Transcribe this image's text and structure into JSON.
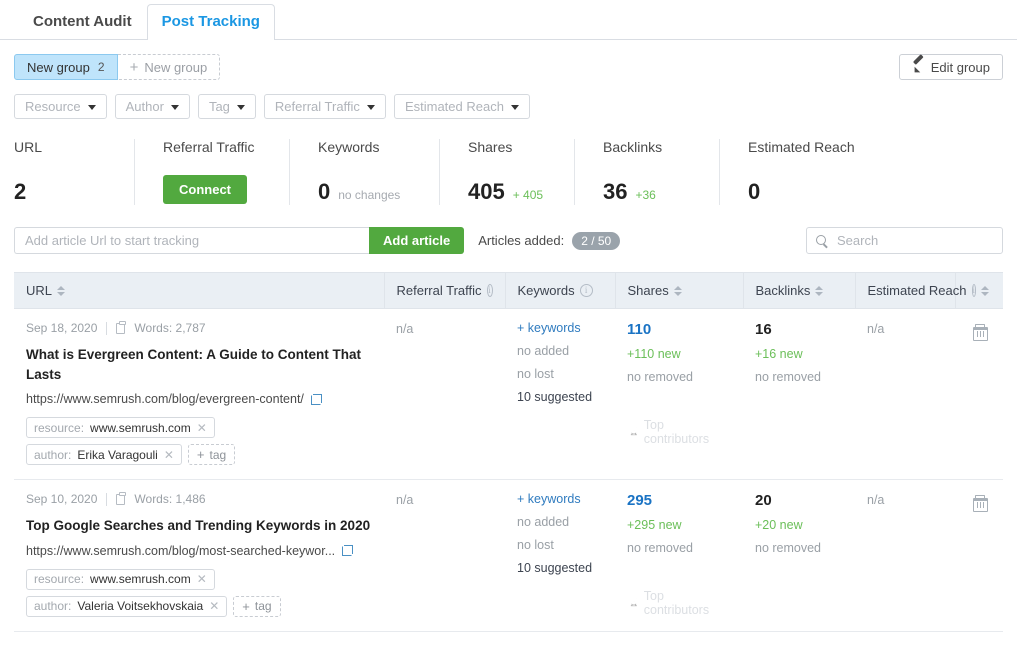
{
  "tabs": [
    {
      "label": "Content Audit",
      "active": false
    },
    {
      "label": "Post Tracking",
      "active": true
    }
  ],
  "group_bar": {
    "active_group_label": "New group",
    "active_group_count": "2",
    "new_group_label": "New group",
    "edit_group_label": "Edit group"
  },
  "filters": [
    {
      "label": "Resource"
    },
    {
      "label": "Author"
    },
    {
      "label": "Tag"
    },
    {
      "label": "Referral Traffic"
    },
    {
      "label": "Estimated Reach"
    }
  ],
  "summary": {
    "url": {
      "label": "URL",
      "value": "2"
    },
    "referral_traffic": {
      "label": "Referral Traffic",
      "button": "Connect"
    },
    "keywords": {
      "label": "Keywords",
      "value": "0",
      "delta": "no changes"
    },
    "shares": {
      "label": "Shares",
      "value": "405",
      "delta": "+ 405"
    },
    "backlinks": {
      "label": "Backlinks",
      "value": "36",
      "delta": "+36"
    },
    "estimated_reach": {
      "label": "Estimated Reach",
      "value": "0"
    }
  },
  "add_bar": {
    "url_placeholder": "Add article Url to start tracking",
    "url_value": "",
    "add_button": "Add article",
    "articles_added_label": "Articles added:",
    "articles_added_count": "2 / 50",
    "search_placeholder": "Search",
    "search_value": ""
  },
  "table": {
    "columns": [
      {
        "label": "URL",
        "sortable": true,
        "info": false
      },
      {
        "label": "Referral Traffic",
        "sortable": false,
        "info": true
      },
      {
        "label": "Keywords",
        "sortable": false,
        "info": true
      },
      {
        "label": "Shares",
        "sortable": true,
        "info": false
      },
      {
        "label": "Backlinks",
        "sortable": true,
        "info": false
      },
      {
        "label": "Estimated Reach",
        "sortable": true,
        "info": true
      },
      {
        "label": "",
        "sortable": false,
        "info": false
      }
    ],
    "rows": [
      {
        "date": "Sep 18, 2020",
        "words": "Words: 2,787",
        "title": "What is Evergreen Content: A Guide to Content That Lasts",
        "url": "https://www.semrush.com/blog/evergreen-content/",
        "tags": [
          {
            "key": "resource:",
            "value": "www.semrush.com"
          },
          {
            "key": "author:",
            "value": "Erika Varagouli"
          }
        ],
        "add_tag_label": "tag",
        "referral_traffic": "n/a",
        "keywords": {
          "link": "+ keywords",
          "added": "no added",
          "lost": "no lost",
          "suggested": "10 suggested"
        },
        "shares": {
          "value": "110",
          "new": "+110 new",
          "removed": "no removed",
          "top_contributors": "Top contributors"
        },
        "backlinks": {
          "value": "16",
          "new": "+16 new",
          "removed": "no removed"
        },
        "estimated_reach": "n/a"
      },
      {
        "date": "Sep 10, 2020",
        "words": "Words: 1,486",
        "title": "Top Google Searches and Trending Keywords in 2020",
        "url": "https://www.semrush.com/blog/most-searched-keywor...",
        "tags": [
          {
            "key": "resource:",
            "value": "www.semrush.com"
          },
          {
            "key": "author:",
            "value": "Valeria Voitsekhovskaia"
          }
        ],
        "add_tag_label": "tag",
        "referral_traffic": "n/a",
        "keywords": {
          "link": "+ keywords",
          "added": "no added",
          "lost": "no lost",
          "suggested": "10 suggested"
        },
        "shares": {
          "value": "295",
          "new": "+295 new",
          "removed": "no removed",
          "top_contributors": "Top contributors"
        },
        "backlinks": {
          "value": "20",
          "new": "+20 new",
          "removed": "no removed"
        },
        "estimated_reach": "n/a"
      }
    ]
  },
  "colors": {
    "accent_blue": "#1b97e3",
    "link_blue": "#1a73c4",
    "green": "#52a93f",
    "delta_green": "#6bbf59",
    "chip_blue": "#bfe4fb",
    "header_bg": "#eaeff4",
    "muted": "#9aa0a6"
  }
}
